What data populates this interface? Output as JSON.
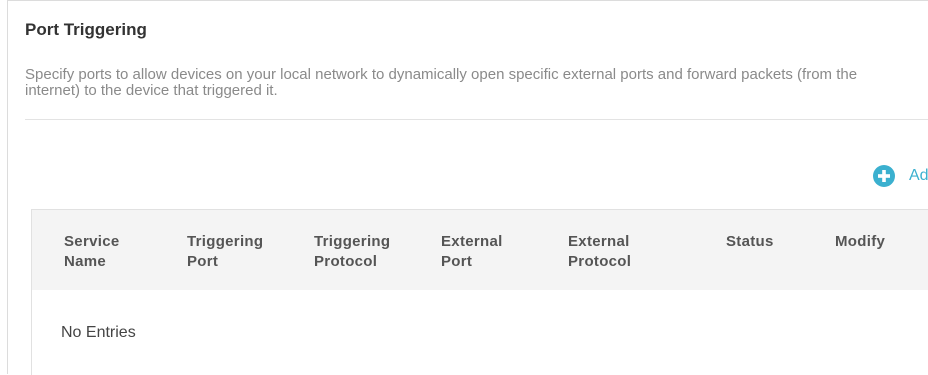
{
  "section": {
    "title": "Port Triggering",
    "description": "Specify ports to allow devices on your local network to dynamically open specific external ports and forward packets (from the internet) to the device that triggered it."
  },
  "toolbar": {
    "add_label": "Add",
    "add_icon": "plus-circle-icon",
    "accent_color": "#3bb0cf"
  },
  "table": {
    "columns": [
      {
        "line1": "Service",
        "line2": "Name"
      },
      {
        "line1": "Triggering",
        "line2": "Port"
      },
      {
        "line1": "Triggering",
        "line2": "Protocol"
      },
      {
        "line1": "External",
        "line2": "Port"
      },
      {
        "line1": "External",
        "line2": "Protocol"
      },
      {
        "line1": "Status",
        "line2": ""
      },
      {
        "line1": "Modify",
        "line2": ""
      }
    ],
    "rows": [],
    "empty_text": "No Entries"
  }
}
